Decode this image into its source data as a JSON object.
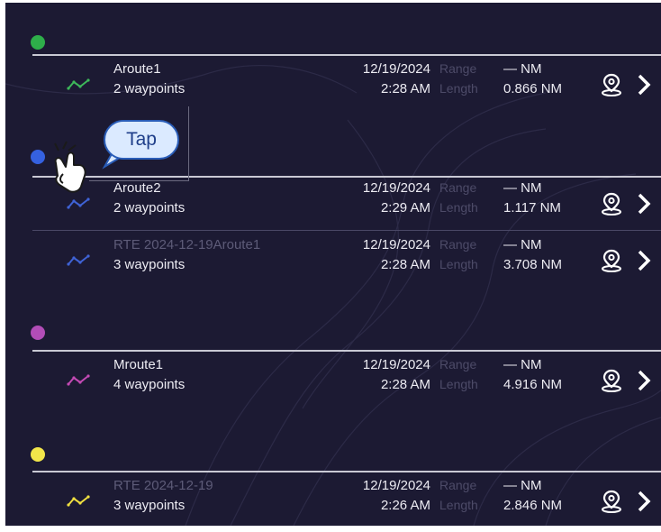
{
  "groups": [
    {
      "color": "#2eae4a",
      "routes": [
        {
          "name": "Aroute1",
          "name_dim": false,
          "waypoints": "2 waypoints",
          "date": "12/19/2024",
          "time": "2:28 AM",
          "range_label": "Range",
          "range": "— NM",
          "length_label": "Length",
          "length": "0.866 NM",
          "line_color": "#3db85a",
          "icon": "route-line-icon"
        }
      ]
    },
    {
      "color": "#3561e0",
      "routes": [
        {
          "name": "Aroute2",
          "name_dim": false,
          "waypoints": "2 waypoints",
          "date": "12/19/2024",
          "time": "2:29 AM",
          "range_label": "Range",
          "range": "— NM",
          "length_label": "Length",
          "length": "1.117 NM",
          "line_color": "#3f63d6",
          "icon": "route-line-icon"
        },
        {
          "name": "RTE 2024-12-19Aroute1",
          "name_dim": true,
          "waypoints": "3 waypoints",
          "date": "12/19/2024",
          "time": "2:28 AM",
          "range_label": "Range",
          "range": "— NM",
          "length_label": "Length",
          "length": "3.708 NM",
          "line_color": "#3f63d6",
          "icon": "route-line-icon"
        }
      ]
    },
    {
      "color": "#b24db7",
      "routes": [
        {
          "name": "Mroute1",
          "name_dim": false,
          "waypoints": "4 waypoints",
          "date": "12/19/2024",
          "time": "2:28 AM",
          "range_label": "Range",
          "range": "— NM",
          "length_label": "Length",
          "length": "4.916 NM",
          "line_color": "#c44ab5",
          "icon": "route-line-icon"
        }
      ]
    },
    {
      "color": "#f2e64a",
      "routes": [
        {
          "name": "RTE 2024-12-19",
          "name_dim": true,
          "waypoints": "3 waypoints",
          "date": "12/19/2024",
          "time": "2:26 AM",
          "range_label": "Range",
          "range": "— NM",
          "length_label": "Length",
          "length": "2.846 NM",
          "line_color": "#f0e040",
          "icon": "route-line-icon"
        }
      ]
    }
  ],
  "callout": {
    "label": "Tap",
    "icon": "tap-hand-icon"
  },
  "row_icons": {
    "pin": "waypoint-pin-icon",
    "chevron": "chevron-right-icon"
  }
}
